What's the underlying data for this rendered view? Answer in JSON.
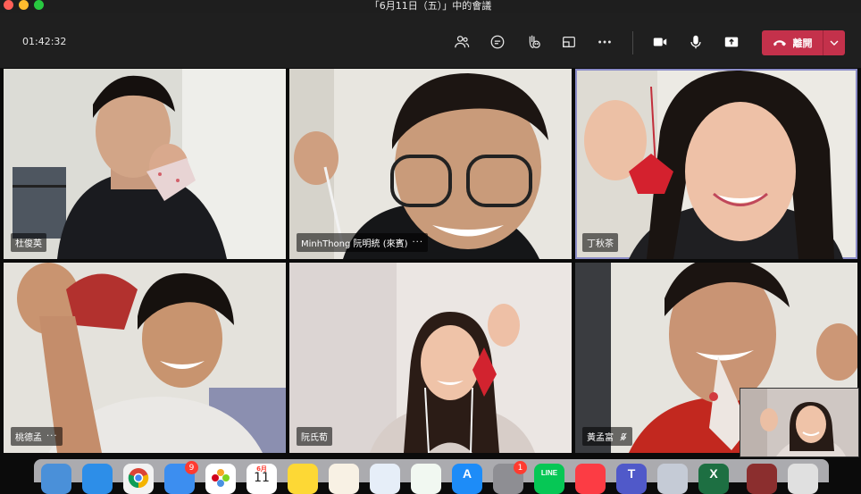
{
  "window": {
    "title": "「6月11日（五）」中的會議"
  },
  "toolbar": {
    "timer": "01:42:32",
    "icons": [
      "people-icon",
      "chat-icon",
      "reactions-icon",
      "rooms-icon",
      "more-icon",
      "camera-icon",
      "mic-icon",
      "share-icon"
    ],
    "leave_label": "離開"
  },
  "participants": [
    {
      "name": "杜俊英",
      "more": ""
    },
    {
      "name": "MinhThong 阮明統 (來賓)",
      "more": "···"
    },
    {
      "name": "丁秋茶",
      "more": ""
    },
    {
      "name": "桃德孟",
      "more": "···"
    },
    {
      "name": "阮氏荀",
      "more": ""
    },
    {
      "name": "黃孟富",
      "more": ""
    }
  ],
  "dock": {
    "mail_badge": "9",
    "calendar_month": "6月",
    "calendar_day": "11",
    "settings_badge": "1",
    "line_label": "LINE"
  },
  "colors": {
    "leave": "#c4314b",
    "active_border": "#8b8cc7",
    "toolbar_bg": "#1f1f1f"
  }
}
